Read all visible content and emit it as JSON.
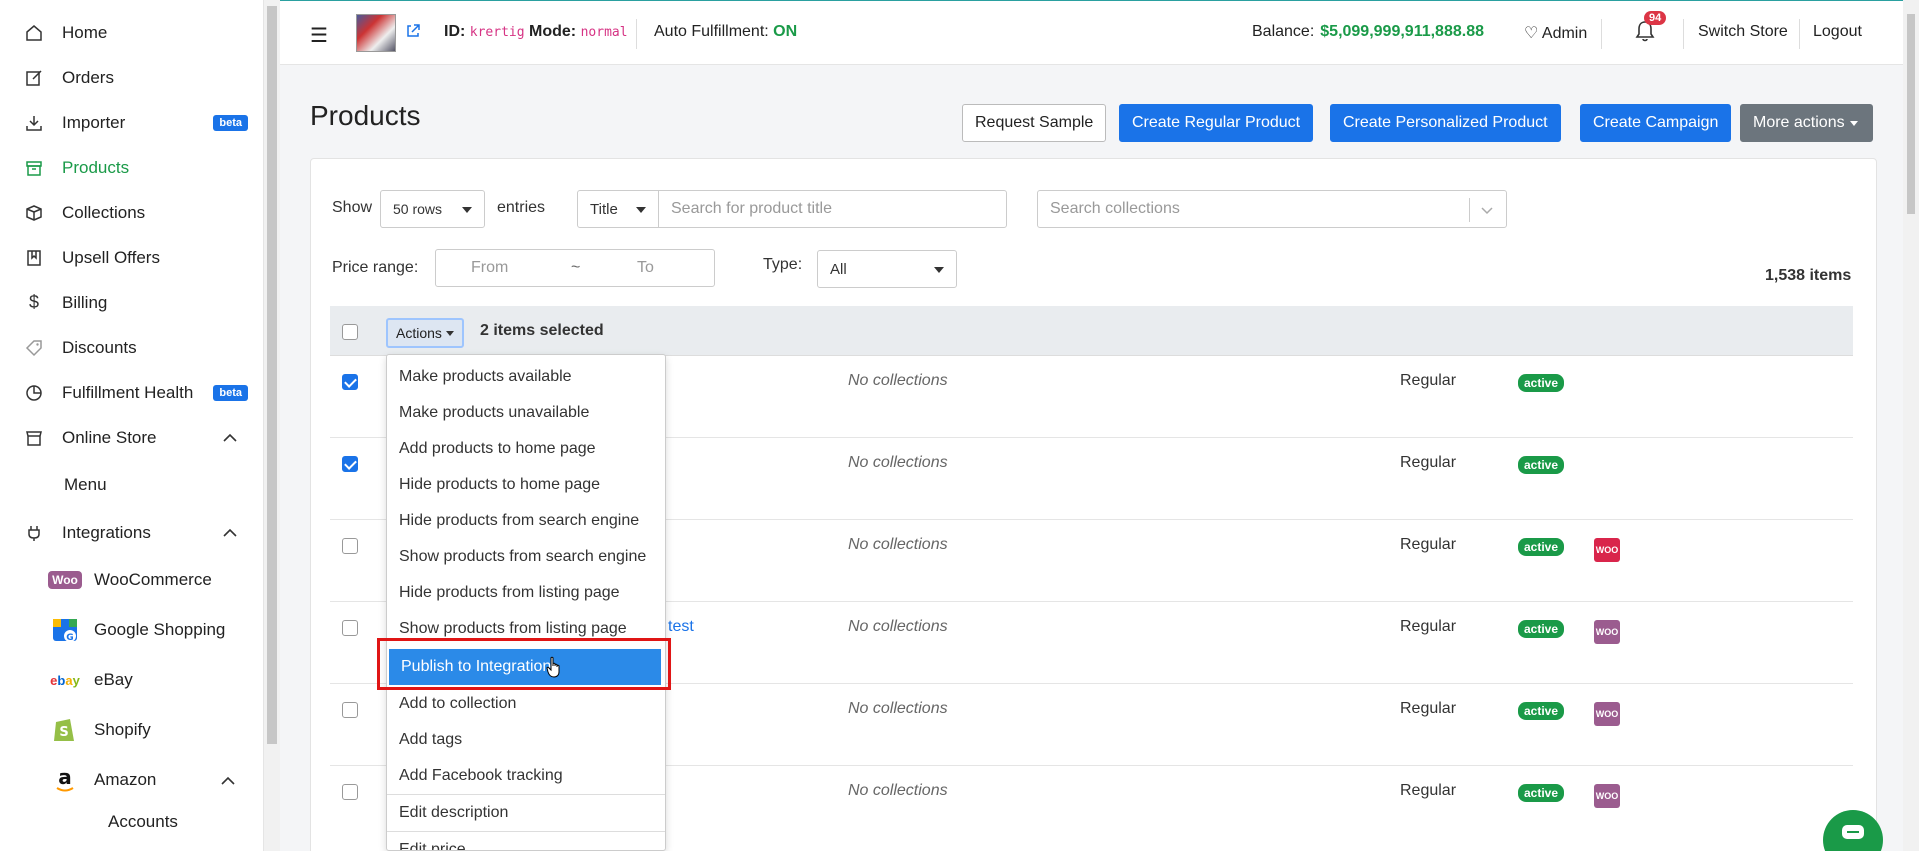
{
  "sidebar": {
    "items": [
      {
        "label": "Home",
        "icon": "home-icon"
      },
      {
        "label": "Orders",
        "icon": "edit-icon"
      },
      {
        "label": "Importer",
        "icon": "download-icon",
        "badge": "beta"
      },
      {
        "label": "Products",
        "icon": "archive-icon",
        "active": true
      },
      {
        "label": "Collections",
        "icon": "box-icon"
      },
      {
        "label": "Upsell Offers",
        "icon": "book-icon"
      },
      {
        "label": "Billing",
        "icon": "dollar-icon"
      },
      {
        "label": "Discounts",
        "icon": "tag-icon"
      },
      {
        "label": "Fulfillment Health",
        "icon": "pie-chart-icon",
        "badge": "beta"
      },
      {
        "label": "Online Store",
        "icon": "store-icon"
      },
      {
        "label": "Integrations",
        "icon": "plug-icon"
      }
    ],
    "online_store_sub": "Menu",
    "integrations": [
      "WooCommerce",
      "Google Shopping",
      "eBay",
      "Shopify",
      "Amazon"
    ],
    "amazon_sub": [
      "Accounts"
    ]
  },
  "topbar": {
    "id_label": "ID:",
    "id_value": "krertig",
    "mode_label": "Mode:",
    "mode_value": "normal",
    "auto_label": "Auto Fulfillment:",
    "auto_value": "ON",
    "balance_label": "Balance:",
    "balance_value": "$5,099,999,911,888.88",
    "admin_label": "Admin",
    "notif_count": "94",
    "switch_store": "Switch Store",
    "logout": "Logout"
  },
  "header": {
    "title": "Products",
    "buttons": {
      "request_sample": "Request Sample",
      "create_regular": "Create Regular Product",
      "create_personalized": "Create Personalized Product",
      "create_campaign": "Create Campaign",
      "more_actions": "More actions"
    }
  },
  "filters": {
    "show_label": "Show",
    "rows_value": "50 rows",
    "entries_label": "entries",
    "search_field": "Title",
    "search_placeholder": "Search for product title",
    "collections_placeholder": "Search collections",
    "price_label": "Price range:",
    "price_from": "From",
    "price_sep": "~",
    "price_to": "To",
    "type_label": "Type:",
    "type_value": "All",
    "items_count": "1,538 items"
  },
  "table": {
    "actions_label": "Actions",
    "selected_text": "2 items selected",
    "rows": [
      {
        "checked": true,
        "collections": "No collections",
        "type": "Regular",
        "status": "active",
        "integration": ""
      },
      {
        "checked": true,
        "collections": "No collections",
        "type": "Regular",
        "status": "active",
        "integration": ""
      },
      {
        "checked": false,
        "collections": "No collections",
        "type": "Regular",
        "status": "active",
        "integration": "woo-red"
      },
      {
        "checked": false,
        "collections": "No collections",
        "type": "Regular",
        "status": "active",
        "integration": "woo",
        "title_fragment": "test"
      },
      {
        "checked": false,
        "collections": "No collections",
        "type": "Regular",
        "status": "active",
        "integration": "woo"
      },
      {
        "checked": false,
        "collections": "No collections",
        "type": "Regular",
        "status": "active",
        "integration": "woo"
      }
    ]
  },
  "dropdown": {
    "items": [
      "Make products available",
      "Make products unavailable",
      "Add products to home page",
      "Hide products to home page",
      "Hide products from search engine",
      "Show products from search engine",
      "Hide products from listing page",
      "Show products from listing page",
      "Publish to Integration",
      "Add to collection",
      "Add tags",
      "Add Facebook tracking",
      "Edit description",
      "Edit price"
    ],
    "highlighted_index": 8
  },
  "colors": {
    "accent_green": "#1a9a48",
    "primary_blue": "#1a73e8",
    "highlight_red": "#e01515",
    "woo_purple": "#9b5c8f",
    "woo_red": "#d9254b"
  }
}
